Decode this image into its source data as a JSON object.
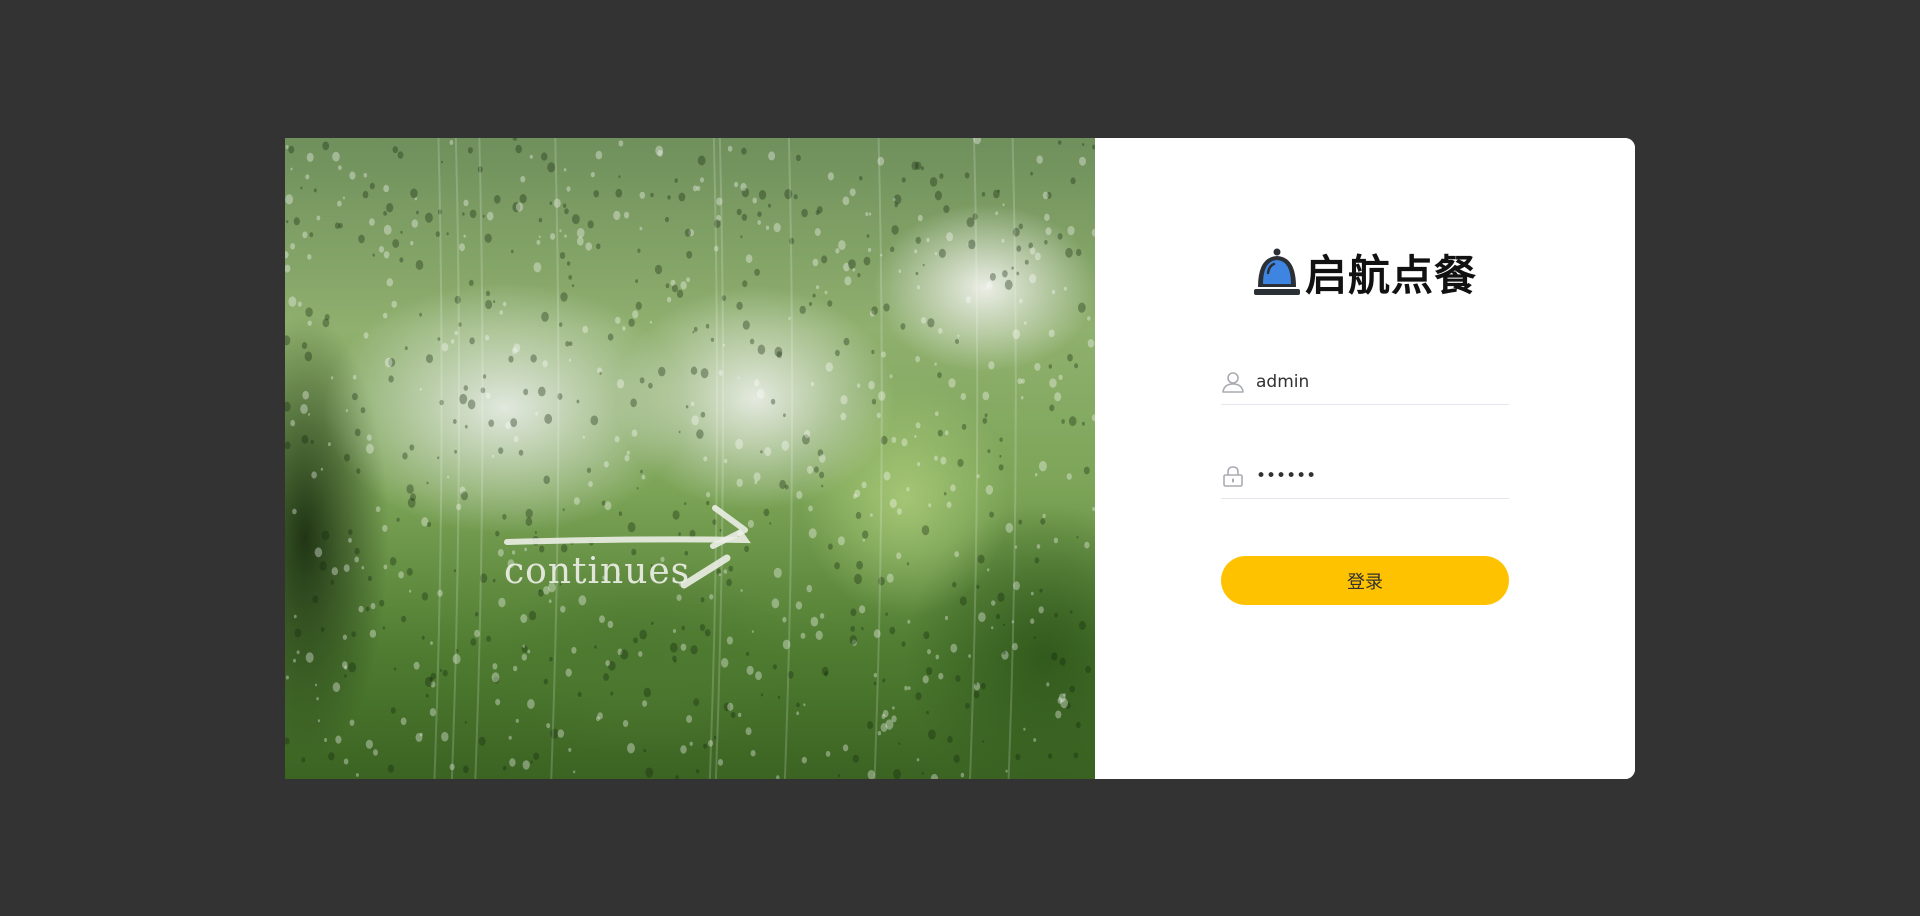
{
  "brand": {
    "title": "启航点餐",
    "icon": "service-bell-icon"
  },
  "hero": {
    "caption": "continues"
  },
  "login_form": {
    "username": {
      "value": "admin",
      "icon": "user-icon"
    },
    "password": {
      "value": "123456",
      "icon": "lock-icon"
    },
    "submit_label": "登录"
  },
  "colors": {
    "page_background": "#333333",
    "card_background": "#ffffff",
    "accent": "#ffc200",
    "brand_icon_blue": "#3d85e0",
    "brand_icon_dark": "#2b2f36"
  }
}
